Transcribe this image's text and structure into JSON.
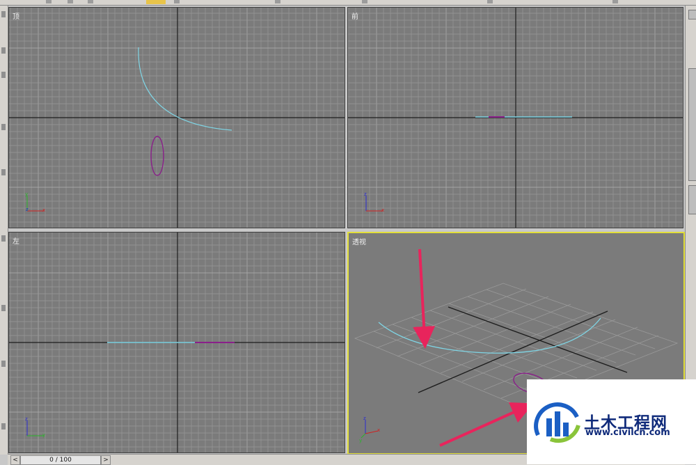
{
  "viewports": {
    "top": {
      "label": "顶"
    },
    "front": {
      "label": "前"
    },
    "left": {
      "label": "左"
    },
    "perspective": {
      "label": "透视"
    }
  },
  "timeline": {
    "position_text": "0 / 100",
    "prev_glyph": "<",
    "next_glyph": ">"
  },
  "axis_tripod": {
    "x": "x",
    "y": "y",
    "z": "z"
  },
  "watermark": {
    "name": "土木工程网",
    "url": "www.civilcn.com"
  },
  "colors": {
    "viewport_bg": "#7b7b7b",
    "grid_line": "#9c9c9c",
    "world_axis": "#1e1e1e",
    "arc_curve": "#7fd6e6",
    "ellipse_curve": "#8a1f8a",
    "active_border": "#e3df3a",
    "annotation_arrow": "#e8245c"
  }
}
